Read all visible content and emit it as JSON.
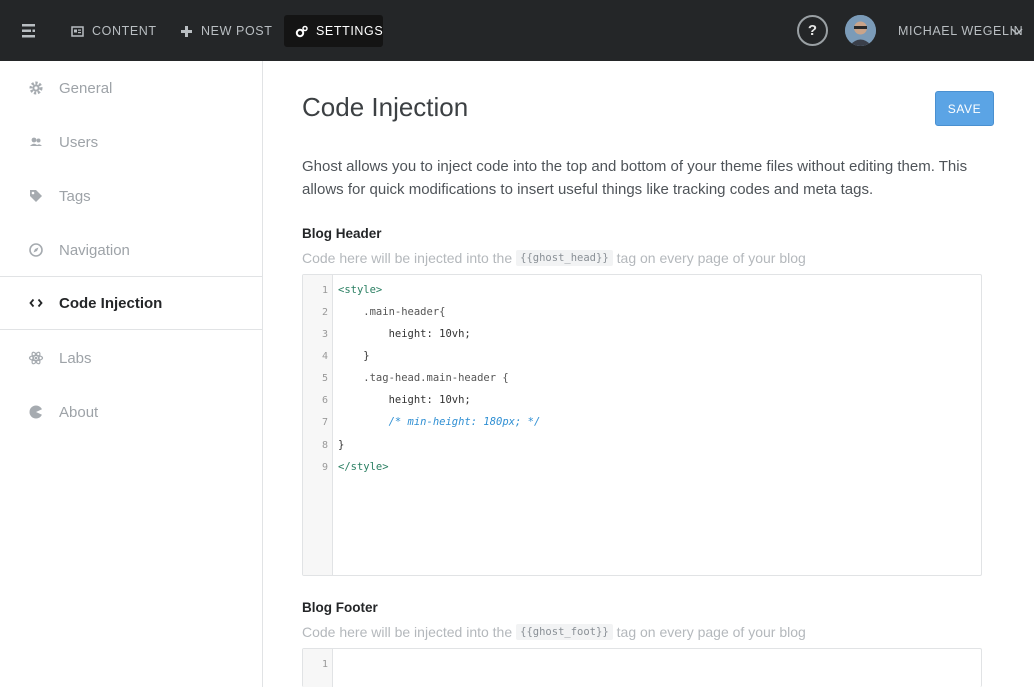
{
  "topbar": {
    "menu_icon": "menu-icon",
    "tabs": [
      {
        "label": "CONTENT",
        "icon": "content-icon"
      },
      {
        "label": "NEW POST",
        "icon": "plus-icon"
      },
      {
        "label": "SETTINGS",
        "icon": "gears-icon"
      }
    ],
    "help_label": "?",
    "user_name": "MICHAEL WEGELIN"
  },
  "sidebar": {
    "items": [
      {
        "label": "General",
        "icon": "gear-icon"
      },
      {
        "label": "Users",
        "icon": "users-icon"
      },
      {
        "label": "Tags",
        "icon": "tag-icon"
      },
      {
        "label": "Navigation",
        "icon": "compass-icon"
      },
      {
        "label": "Code Injection",
        "icon": "code-icon"
      },
      {
        "label": "Labs",
        "icon": "atom-icon"
      },
      {
        "label": "About",
        "icon": "ghost-icon"
      }
    ],
    "active_index": 4
  },
  "main": {
    "title": "Code Injection",
    "save_label": "SAVE",
    "intro": "Ghost allows you to inject code into the top and bottom of your theme files without editing them. This allows for quick modifications to insert useful things like tracking codes and meta tags.",
    "header": {
      "label": "Blog Header",
      "help_before": "Code here will be injected into the",
      "help_code": "{{ghost_head}}",
      "help_after": "tag on every page of your blog",
      "line_numbers": [
        "1",
        "2",
        "3",
        "4",
        "5",
        "6",
        "7",
        "8",
        "9"
      ],
      "lines": [
        "<style>",
        "    .main-header{",
        "        height: 10vh;",
        "    }",
        "    .tag-head.main-header {",
        "        height: 10vh;",
        "        /* min-height: 180px; */",
        "}",
        "</style>"
      ]
    },
    "footer": {
      "label": "Blog Footer",
      "help_before": "Code here will be injected into the",
      "help_code": "{{ghost_foot}}",
      "help_after": "tag on every page of your blog",
      "line_numbers": [
        "1"
      ]
    }
  },
  "colors": {
    "topbar_bg": "#242628",
    "accent": "#5ba4e5",
    "active_text": "#242628"
  }
}
